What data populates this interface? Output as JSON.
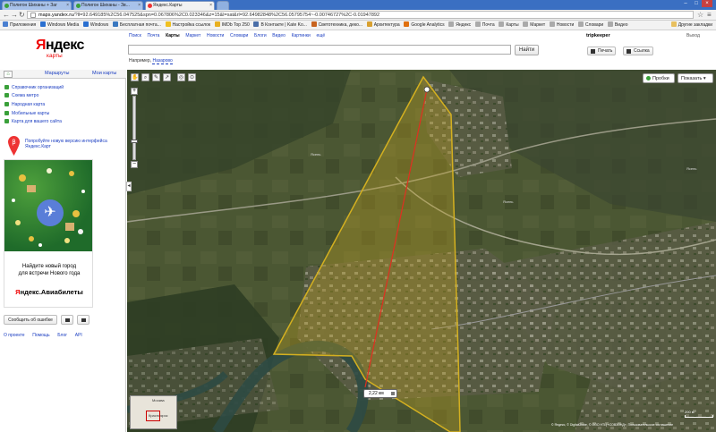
{
  "browser": {
    "tabs": [
      {
        "label": "Полигон Шиханы + Заг"
      },
      {
        "label": "Полигон Шиханы - Зв..."
      },
      {
        "label": "Яндекс.Карты"
      }
    ],
    "url_prefix": "maps.yandex.ru",
    "url_rest": "/?ll=92.649185%2C56.047525&spn=0.067806%2C0.023346&z=15&l=sat&rl=92.64982848%2C56.05795754~-0.00746727%2C-0.01947892",
    "bookmarks": [
      "Приложения",
      "Windows Media",
      "Windows",
      "Бесплатная почта...",
      "Настройка ссылок",
      "IMDb Top 250",
      "В Контакте | Kate Ko...",
      "Светотехника, деко...",
      "Архитектура",
      "Google Analytics",
      "Яндекс",
      "Почта",
      "Карты",
      "Маркет",
      "Новости",
      "Словари",
      "Видео"
    ],
    "bookmarks_other": "Другие закладки"
  },
  "header": {
    "logo_main_1": "Я",
    "logo_main_2": "ндекс",
    "logo_sub": "карты",
    "services": [
      "Поиск",
      "Почта",
      "Карты",
      "Маркет",
      "Новости",
      "Словари",
      "Блоги",
      "Видео",
      "Картинки",
      "ещё"
    ],
    "current_service": "Карты",
    "user": "tripkeeper",
    "logout": "Выход",
    "search_value": "",
    "find_label": "Найти",
    "print_label": "Печать",
    "link_label": "Ссылка",
    "example_prefix": "Например,",
    "example_link": "Назарово"
  },
  "sidebar": {
    "tabs": [
      "Маршруты",
      "Мои карты"
    ],
    "links": [
      "Справочник организаций",
      "Схема метро",
      "Народная карта",
      "Мобильные карты",
      "Карта для вашего сайта"
    ],
    "new_version": "Попробуйте новую версию интерфейса Яндекс.Карт",
    "ad_line1": "Найдите новый город",
    "ad_line2": "для встречи Нового года",
    "ad_brand_1": "Я",
    "ad_brand_2": "ндекс.Авиабилеты",
    "report_label": "Сообщить об ошибке",
    "footer": [
      "О проекте",
      "Помощь",
      "Блог",
      "API"
    ]
  },
  "map": {
    "traffic_label": "Пробки",
    "show_label": "Показать",
    "distance": "2,22 км",
    "scale": "200 м",
    "copyright": "© Яндекс, © DigitalGlobe, © ООО НТЦ «СОВЗОНД», Пользовательское соглашение",
    "minimap_label": "Москва",
    "minimap_label2": "Красноярск",
    "place_labels": [
      "Ясень",
      "Ясень",
      "Ясень"
    ]
  }
}
